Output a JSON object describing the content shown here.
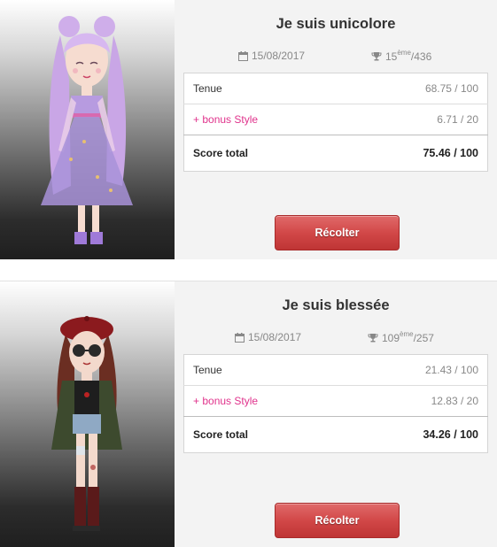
{
  "results": [
    {
      "title": "Je suis unicolore",
      "date": "15/08/2017",
      "rank": "15",
      "rank_suffix": "ème",
      "rank_total": "/436",
      "rows": [
        {
          "label": "Tenue",
          "value": "68.75 / 100"
        },
        {
          "label": "+ bonus Style",
          "value": "6.71 / 20"
        }
      ],
      "total_label": "Score total",
      "total_value": "75.46 / 100",
      "button_label": "Récolter"
    },
    {
      "title": "Je suis blessée",
      "date": "15/08/2017",
      "rank": "109",
      "rank_suffix": "ème",
      "rank_total": "/257",
      "rows": [
        {
          "label": "Tenue",
          "value": "21.43 / 100"
        },
        {
          "label": "+ bonus Style",
          "value": "12.83 / 20"
        }
      ],
      "total_label": "Score total",
      "total_value": "34.26 / 100",
      "button_label": "Récolter"
    }
  ],
  "icons": {
    "date": "calendar-icon",
    "rank": "trophy-icon"
  },
  "colors": {
    "bonus": "#e0338c",
    "button": "#d24848"
  }
}
